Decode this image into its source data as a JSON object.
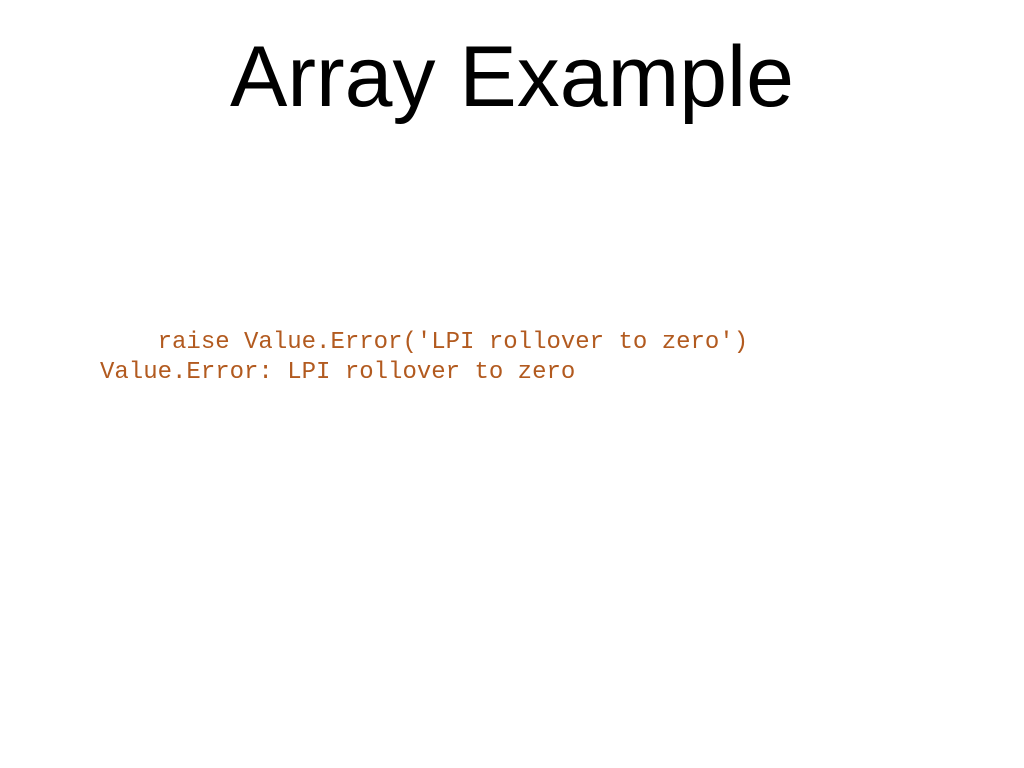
{
  "slide": {
    "title": "Array Example",
    "code": {
      "line1": "    raise Value.Error('LPI rollover to zero')",
      "line2": "Value.Error: LPI rollover to zero"
    }
  }
}
